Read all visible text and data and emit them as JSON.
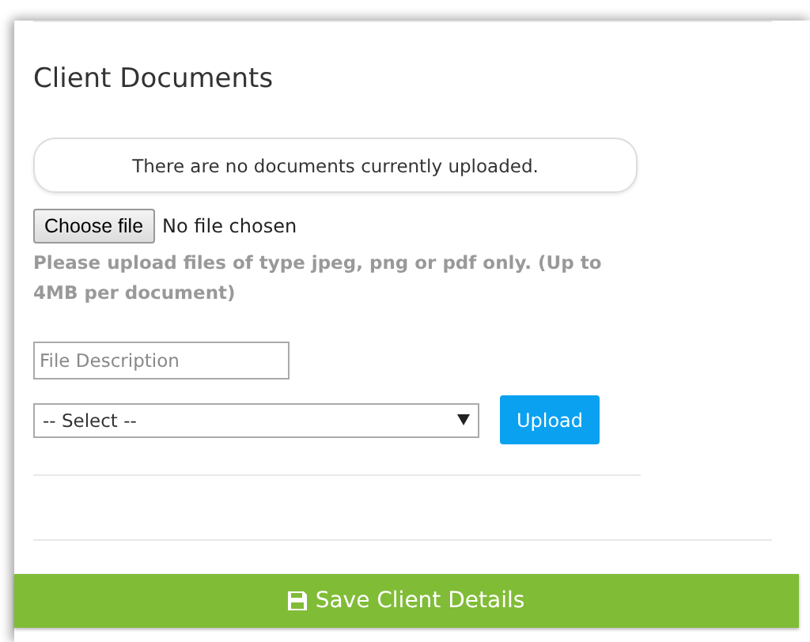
{
  "section": {
    "title": "Client Documents"
  },
  "notice": "There are no documents currently uploaded.",
  "file_input": {
    "button": "Choose file",
    "status": "No file chosen"
  },
  "hint": "Please upload files of type jpeg, png or pdf only. (Up to 4MB per document)",
  "description_field": {
    "placeholder": "File Description"
  },
  "type_select": {
    "value": "-- Select --"
  },
  "upload_button": "Upload",
  "save_button": "Save Client Details"
}
